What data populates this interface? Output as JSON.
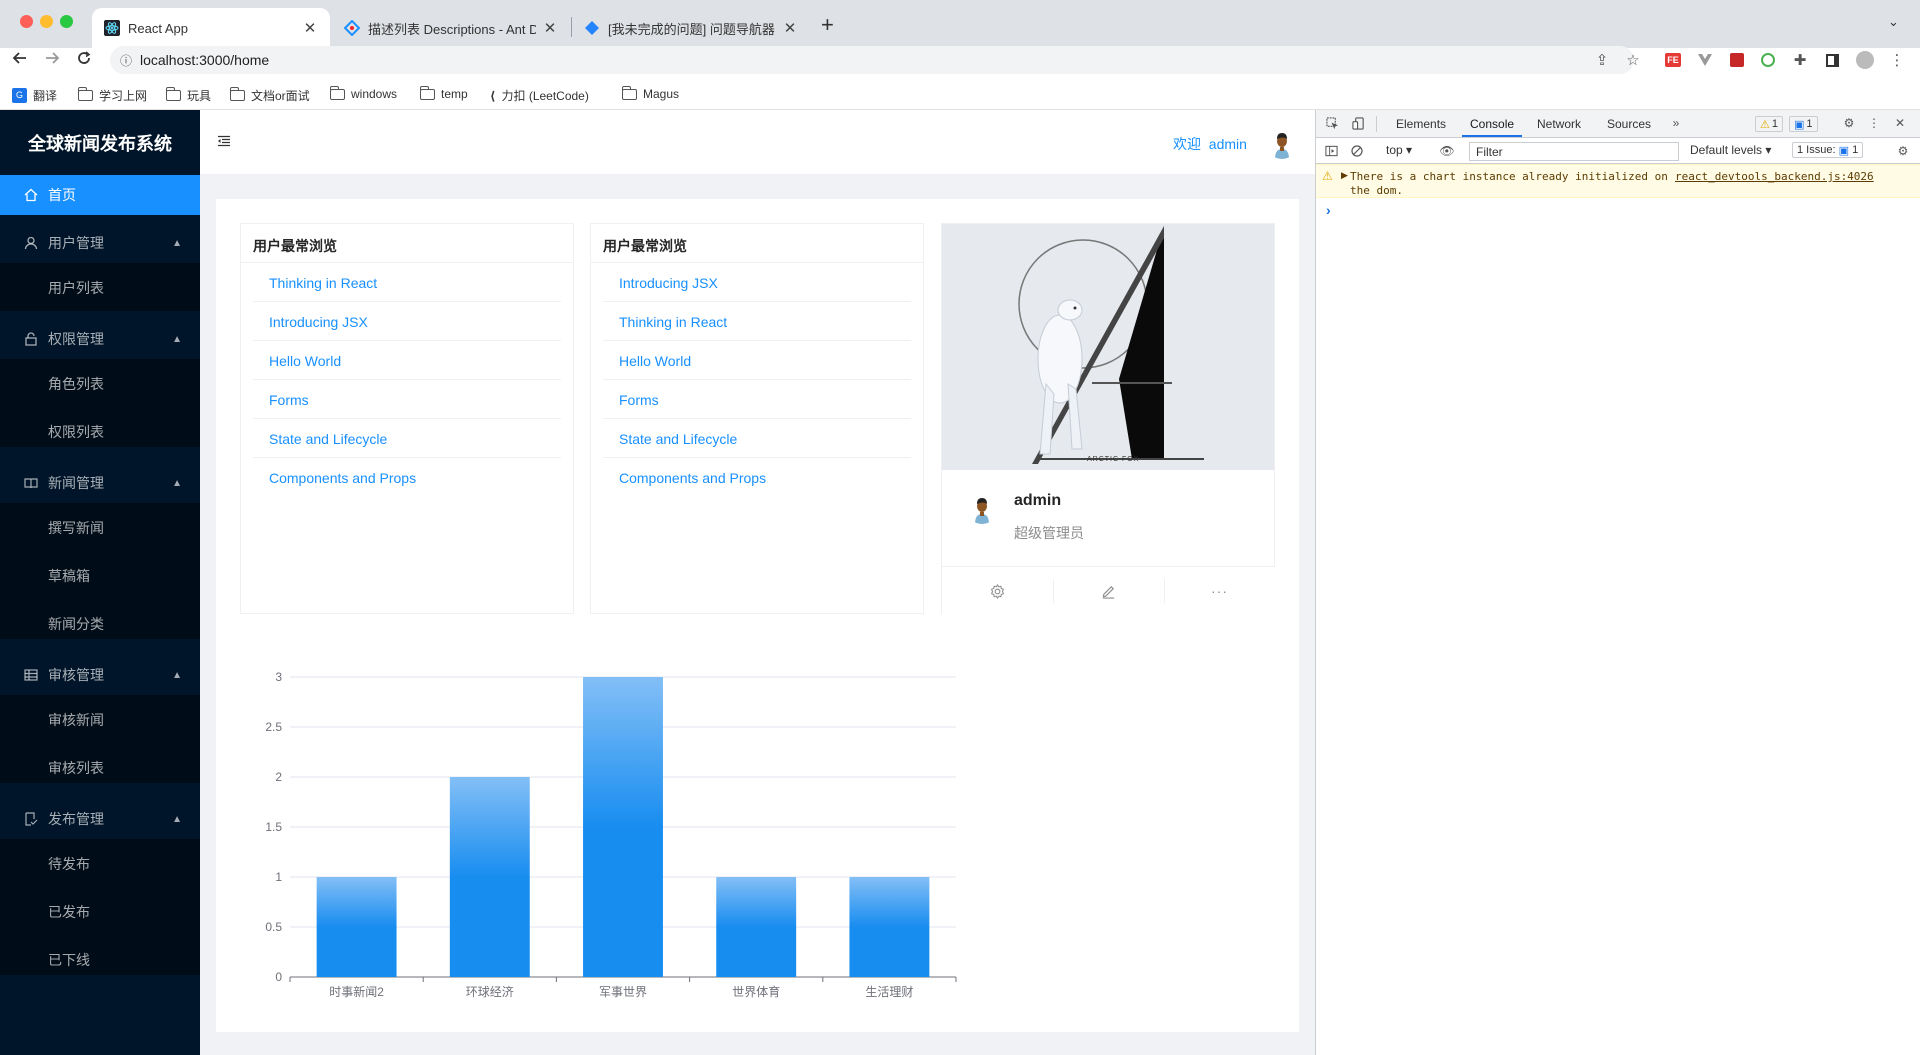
{
  "browser": {
    "tabs": [
      {
        "title": "React App",
        "active": true
      },
      {
        "title": "描述列表 Descriptions - Ant Design",
        "active": false
      },
      {
        "title": "[我未完成的问题] 问题导航器 - JIRA",
        "active": false
      }
    ],
    "url": "localhost:3000/home",
    "bookmarks": [
      "翻译",
      "学习上网",
      "玩具",
      "文档or面试",
      "windows",
      "temp",
      "力扣 (LeetCode)",
      "Magus"
    ]
  },
  "app": {
    "logo": "全球新闻发布系统",
    "menu": {
      "home": "首页",
      "groups": [
        {
          "label": "用户管理",
          "items": [
            "用户列表"
          ]
        },
        {
          "label": "权限管理",
          "items": [
            "角色列表",
            "权限列表"
          ]
        },
        {
          "label": "新闻管理",
          "items": [
            "撰写新闻",
            "草稿箱",
            "新闻分类"
          ]
        },
        {
          "label": "审核管理",
          "items": [
            "审核新闻",
            "审核列表"
          ]
        },
        {
          "label": "发布管理",
          "items": [
            "待发布",
            "已发布",
            "已下线"
          ]
        }
      ]
    },
    "header": {
      "welcome": "欢迎",
      "username": "admin"
    },
    "cards": [
      {
        "title": "用户最常浏览",
        "items": [
          "Thinking in React",
          "Introducing JSX",
          "Hello World",
          "Forms",
          "State and Lifecycle",
          "Components and Props"
        ]
      },
      {
        "title": "用户最常浏览",
        "items": [
          "Introducing JSX",
          "Thinking in React",
          "Hello World",
          "Forms",
          "State and Lifecycle",
          "Components and Props"
        ]
      }
    ],
    "profile": {
      "name": "admin",
      "role": "超级管理员",
      "cover_caption": "ARCTIC FOX"
    }
  },
  "chart_data": {
    "type": "bar",
    "categories": [
      "时事新闻2",
      "环球经济",
      "军事世界",
      "世界体育",
      "生活理财"
    ],
    "values": [
      1,
      2,
      3,
      1,
      1
    ],
    "title": "",
    "xlabel": "",
    "ylabel": "",
    "ylim": [
      0,
      3
    ],
    "yticks": [
      "0",
      "0.5",
      "1",
      "1.5",
      "2",
      "2.5",
      "3"
    ],
    "grid": true,
    "colors": {
      "top": "#83bff6",
      "middle": "#188df0",
      "bottom": "#188df0"
    }
  },
  "devtools": {
    "tabs": [
      "Elements",
      "Console",
      "Network",
      "Sources"
    ],
    "active_tab": "Console",
    "warn_count": "1",
    "msg_count": "1",
    "context": "top",
    "filter_placeholder": "Filter",
    "levels": "Default levels",
    "issues": "1 Issue:",
    "issues_count": "1",
    "warning_text": "There is a chart instance already initialized on the dom.",
    "warning_source": "react_devtools_backend.js:4026",
    "prompt": "›"
  }
}
